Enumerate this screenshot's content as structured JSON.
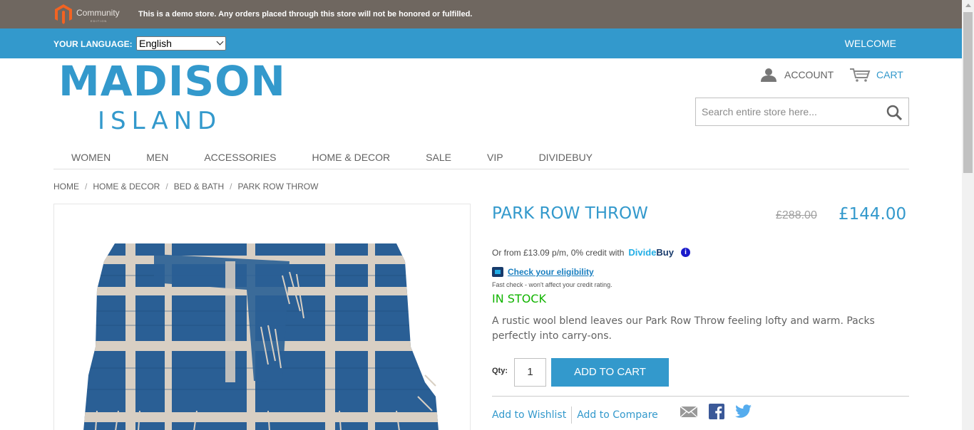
{
  "demo_bar": {
    "logo_text": "Community",
    "logo_sub": "EDITION",
    "message": "This is a demo store. Any orders placed through this store will not be honored or fulfilled."
  },
  "lang_bar": {
    "label": "YOUR LANGUAGE:",
    "selected_language": "English",
    "welcome": "WELCOME"
  },
  "logo": {
    "main": "MADISON",
    "sub": "ISLAND"
  },
  "header": {
    "account_label": "ACCOUNT",
    "cart_label": "CART",
    "search_placeholder": "Search entire store here..."
  },
  "nav": {
    "items": [
      "WOMEN",
      "MEN",
      "ACCESSORIES",
      "HOME & DECOR",
      "SALE",
      "VIP",
      "DIVIDEBUY"
    ]
  },
  "breadcrumb": [
    "HOME",
    "HOME & DECOR",
    "BED & BATH",
    "PARK ROW THROW"
  ],
  "product": {
    "name": "PARK ROW THROW",
    "old_price": "£288.00",
    "price": "£144.00",
    "credit_text": "Or from £13.09 p/m, 0% credit with",
    "dividebuy_part1": "Divide",
    "dividebuy_part2": "Buy",
    "info_glyph": "i",
    "eligibility_link": "Check your eligibility",
    "fast_check": "Fast check - won't affect your credit rating.",
    "stock": "IN STOCK",
    "description": "A rustic wool blend leaves our Park Row Throw feeling lofty and warm. Packs perfectly into carry-ons.",
    "qty_label": "Qty:",
    "qty_value": "1",
    "add_to_cart": "ADD TO CART",
    "add_to_wishlist": "Add to Wishlist",
    "add_to_compare": "Add to Compare"
  },
  "colors": {
    "brand_blue": "#3399cc",
    "demo_bar": "#6f6760",
    "in_stock": "#11b400",
    "throw_blue": "#2a5f95",
    "throw_cream": "#d8cfc3"
  }
}
